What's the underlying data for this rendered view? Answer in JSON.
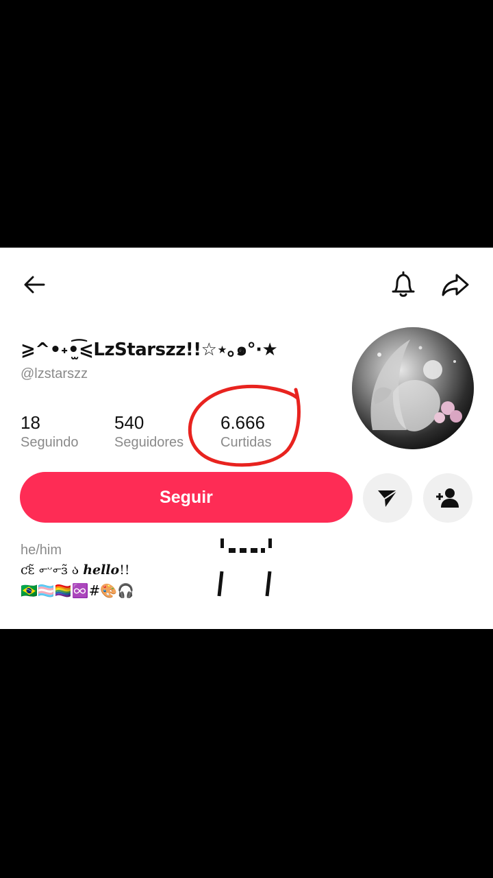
{
  "profile": {
    "display_name": "⩾^•˖•̫͡⩽LzStarszz!!☆⋆｡๑°·★",
    "username": "@lzstarszz",
    "stats": {
      "following": {
        "value": "18",
        "label": "Seguindo"
      },
      "followers": {
        "value": "540",
        "label": "Seguidores"
      },
      "likes": {
        "value": "6.666",
        "label": "Curtidas"
      }
    },
    "follow_label": "Seguir",
    "bio": {
      "pronouns": "he/him",
      "line2_prefix": "ƈɛ̃ ൳ᵕ൳ɜ̃ ა",
      "line2_emphasis": "hello",
      "line2_suffix": "!!",
      "line3": "🇧🇷🏳️‍⚧️🏳️‍🌈♾️#🎨🎧"
    }
  },
  "icons": {
    "back": "arrow-left-icon",
    "bell": "bell-icon",
    "share": "share-arrow-icon",
    "message": "paper-plane-icon",
    "add_friend": "add-user-icon"
  },
  "colors": {
    "accent": "#fe2c55",
    "annotation": "#e8231f",
    "muted": "#8a8a8a",
    "round_button_bg": "#f0f0f0"
  }
}
